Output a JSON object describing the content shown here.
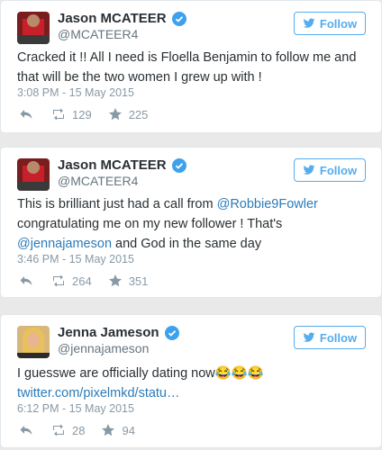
{
  "colors": {
    "accent": "#55acee",
    "link": "#2b7bb9",
    "muted": "#8899a6",
    "verified": "#3ea1ec"
  },
  "tweets": [
    {
      "name": "Jason MCATEER",
      "handle": "@MCATEER4",
      "follow_label": "Follow",
      "text": "Cracked it !! All I need is Floella Benjamin to follow me and that will be the two women I grew up with !",
      "time": "3:08 PM - 15 May 2015",
      "retweets": "129",
      "favorites": "225"
    },
    {
      "name": "Jason MCATEER",
      "handle": "@MCATEER4",
      "follow_label": "Follow",
      "text_parts": {
        "a": "This is brilliant just had a call from ",
        "mention1": "@Robbie9Fowler",
        "b": " congratulating me on my new follower ! That's ",
        "mention2": "@jennajameson",
        "c": " and God in the same day"
      },
      "time": "3:46 PM - 15 May 2015",
      "retweets": "264",
      "favorites": "351"
    },
    {
      "name": "Jenna Jameson",
      "handle": "@jennajameson",
      "follow_label": "Follow",
      "text": "I guesswe are officially dating now😂😂😂",
      "link": "twitter.com/pixelmkd/statu…",
      "time": "6:12 PM - 15 May 2015",
      "retweets": "28",
      "favorites": "94"
    }
  ]
}
